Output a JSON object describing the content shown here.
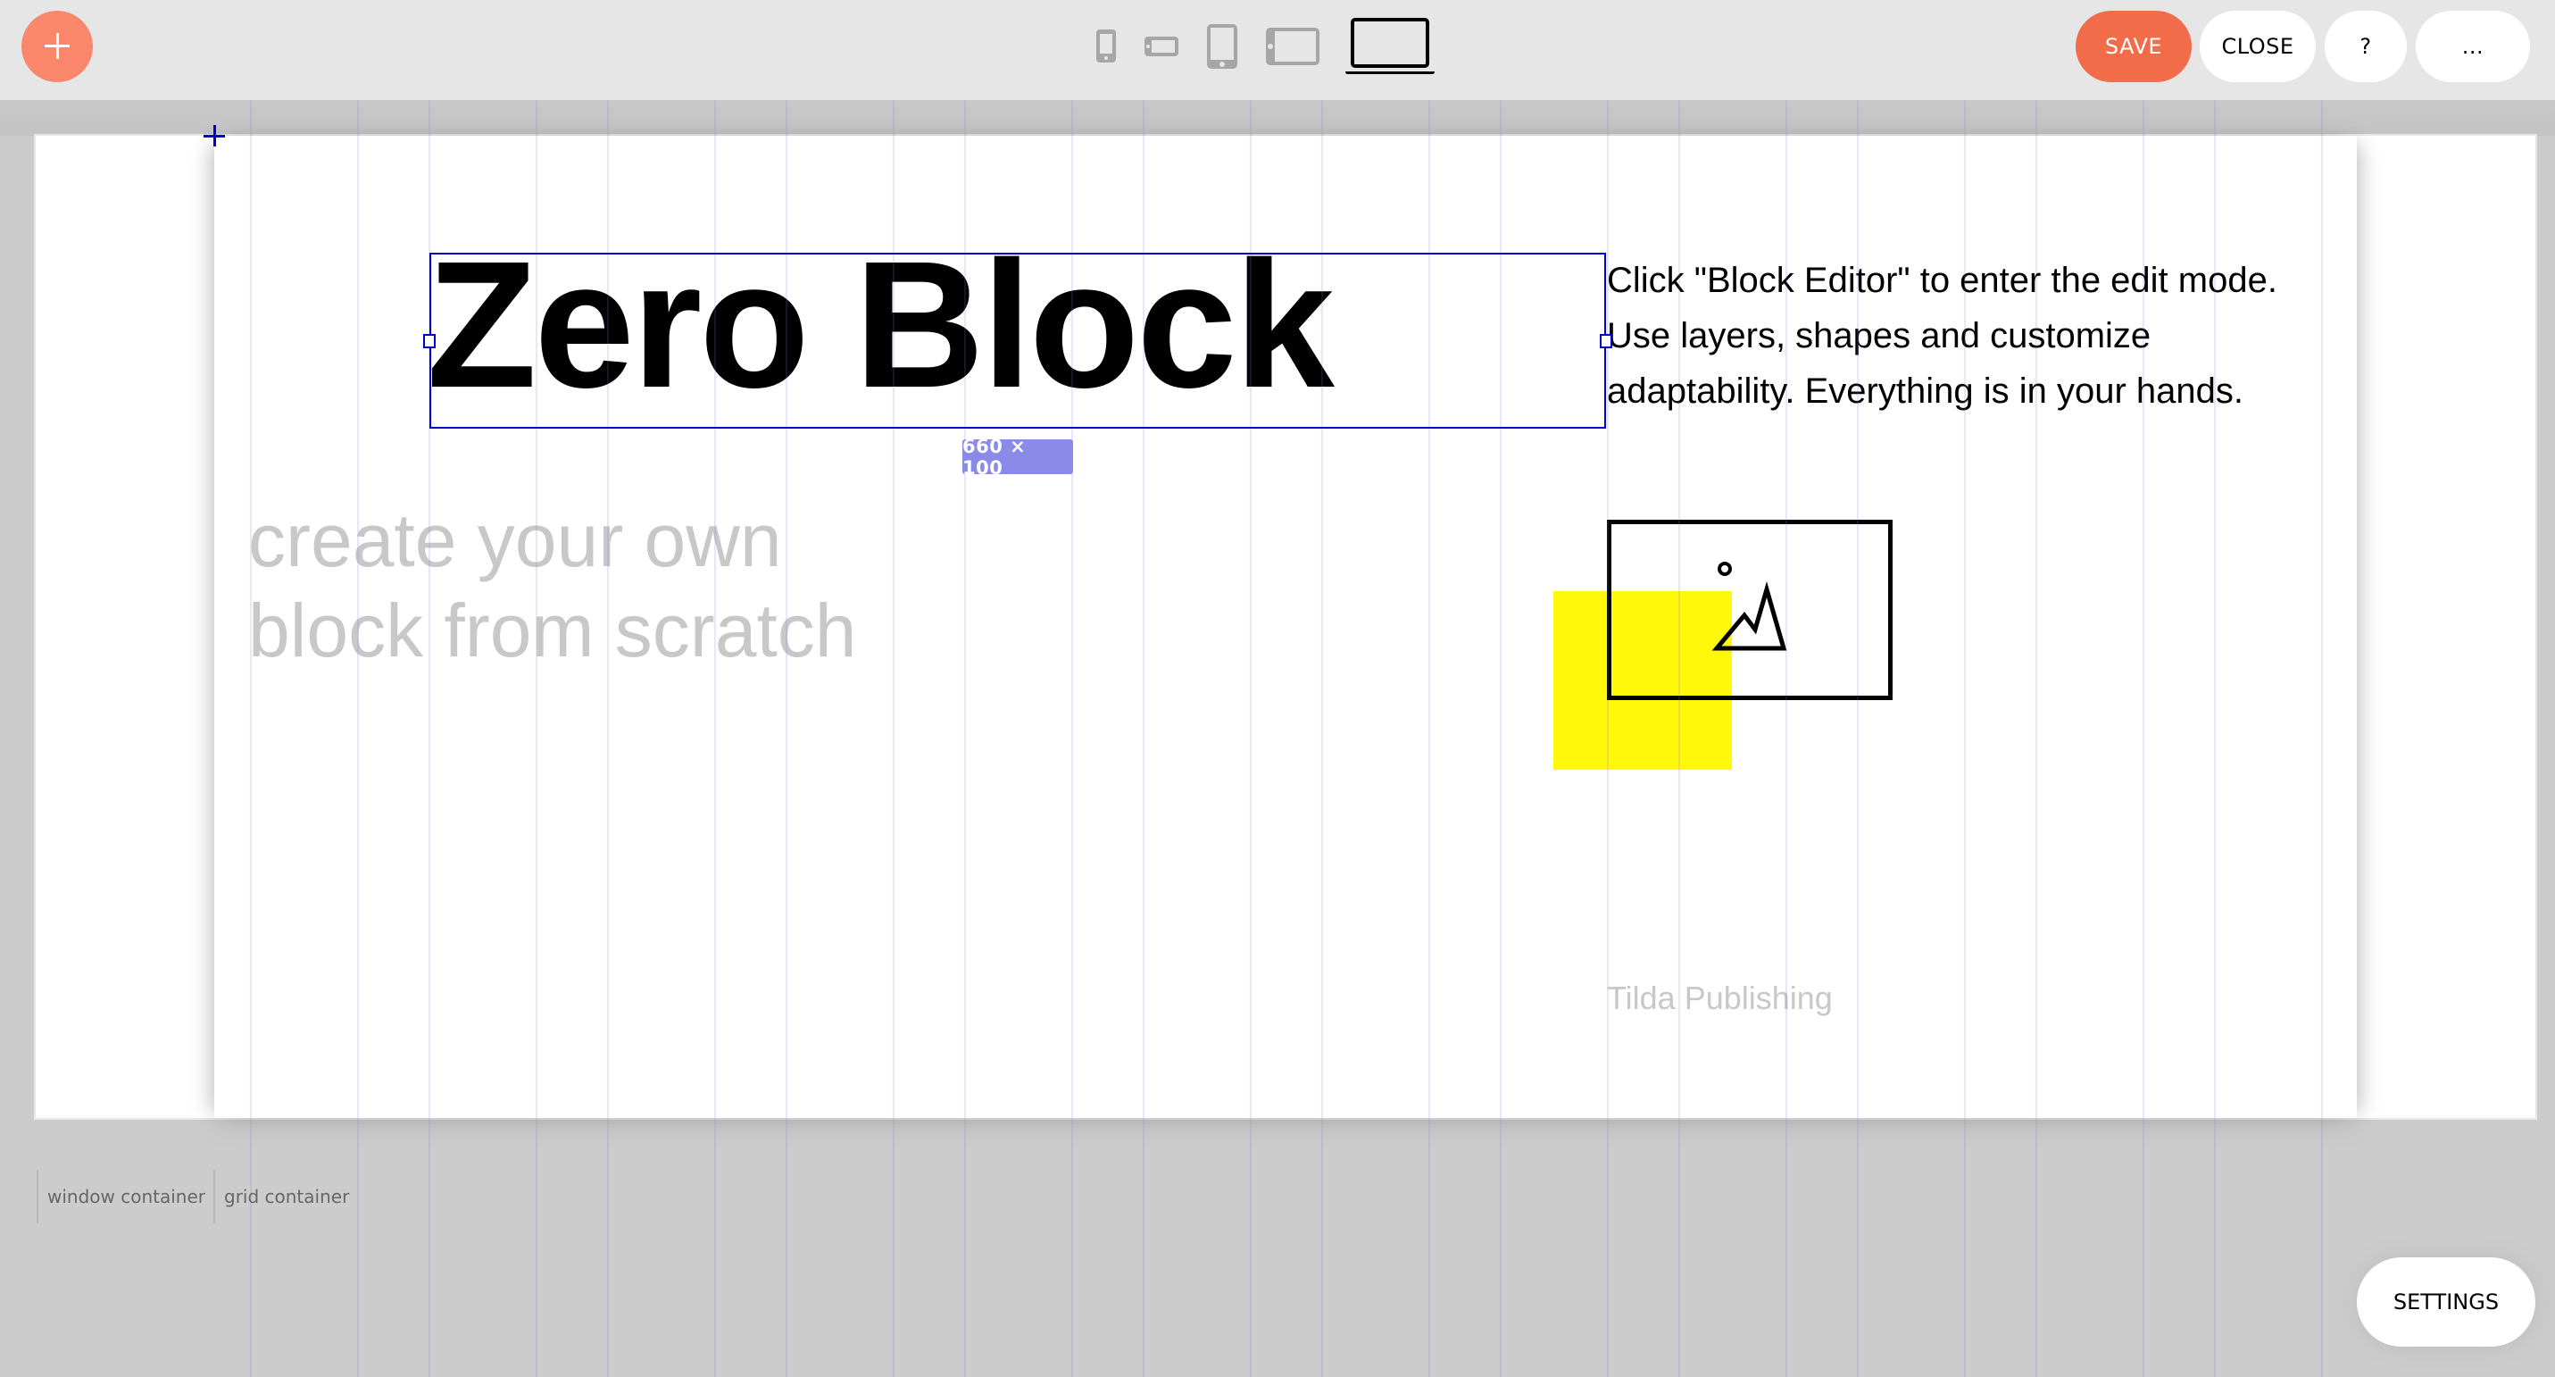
{
  "header": {
    "add_button_icon": "plus-icon",
    "devices": [
      {
        "name": "phone-portrait",
        "icon": "phone-portrait-icon",
        "active": false
      },
      {
        "name": "phone-landscape",
        "icon": "phone-landscape-icon",
        "active": false
      },
      {
        "name": "tablet-portrait",
        "icon": "tablet-portrait-icon",
        "active": false
      },
      {
        "name": "tablet-landscape",
        "icon": "tablet-landscape-icon",
        "active": false
      },
      {
        "name": "desktop",
        "icon": "laptop-icon",
        "active": true
      }
    ],
    "save_label": "SAVE",
    "close_label": "CLOSE",
    "help_label": "?",
    "more_label": "..."
  },
  "canvas": {
    "heading": "Zero Block",
    "selection_size": "660 × 100",
    "subtitle_line1": "create your own",
    "subtitle_line2": "block from scratch",
    "description_line1": "Click \"Block Editor\" to enter the edit mode.",
    "description_line2": "Use layers, shapes and customize",
    "description_line3": "adaptability. Everything is in your hands.",
    "image_icon": "image-mountain-icon",
    "brand_text": "Tilda Publishing"
  },
  "containers": {
    "window_label": "window container",
    "grid_label": "grid container"
  },
  "settings_label": "SETTINGS",
  "colors": {
    "accent": "#f26c4a",
    "add_button": "#fa876b",
    "selection": "#0000cc",
    "badge": "#8a8ae8",
    "shape_yellow": "#fff80a",
    "header_bg": "#e6e6e6",
    "workspace_bg": "#cccccc"
  }
}
